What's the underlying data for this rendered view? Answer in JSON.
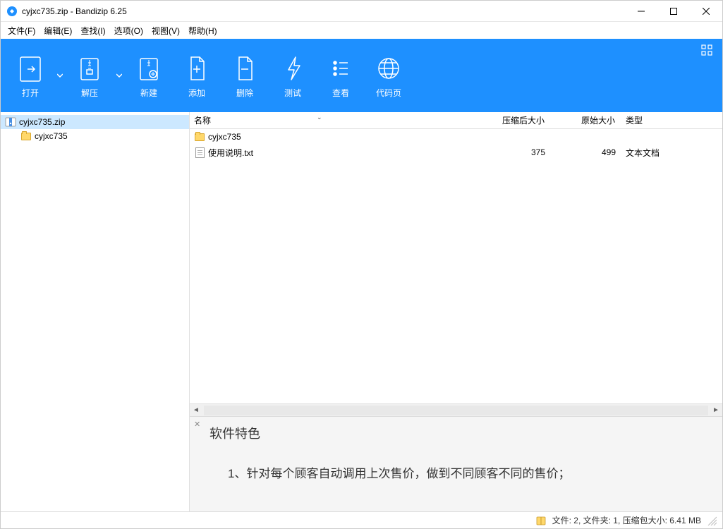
{
  "window": {
    "title": "cyjxc735.zip - Bandizip 6.25"
  },
  "menu": {
    "file": "文件(F)",
    "edit": "编辑(E)",
    "find": "查找(I)",
    "options": "选项(O)",
    "view": "视图(V)",
    "help": "帮助(H)"
  },
  "toolbar": {
    "open": "打开",
    "extract": "解压",
    "new": "新建",
    "add": "添加",
    "delete": "删除",
    "test": "测试",
    "view": "查看",
    "codepage": "代码页"
  },
  "tree": {
    "root": "cyjxc735.zip",
    "child": "cyjxc735"
  },
  "list": {
    "headers": {
      "name": "名称",
      "compressed": "压缩后大小",
      "original": "原始大小",
      "type": "类型"
    },
    "rows": [
      {
        "name": "cyjxc735",
        "compressed": "",
        "original": "",
        "type": "",
        "icon": "folder"
      },
      {
        "name": "使用说明.txt",
        "compressed": "375",
        "original": "499",
        "type": "文本文档",
        "icon": "txt"
      }
    ]
  },
  "preview": {
    "title": "软件特色",
    "line1": "1、针对每个顾客自动调用上次售价，做到不同顾客不同的售价；"
  },
  "status": {
    "text": "文件: 2, 文件夹: 1, 压缩包大小: 6.41 MB"
  }
}
